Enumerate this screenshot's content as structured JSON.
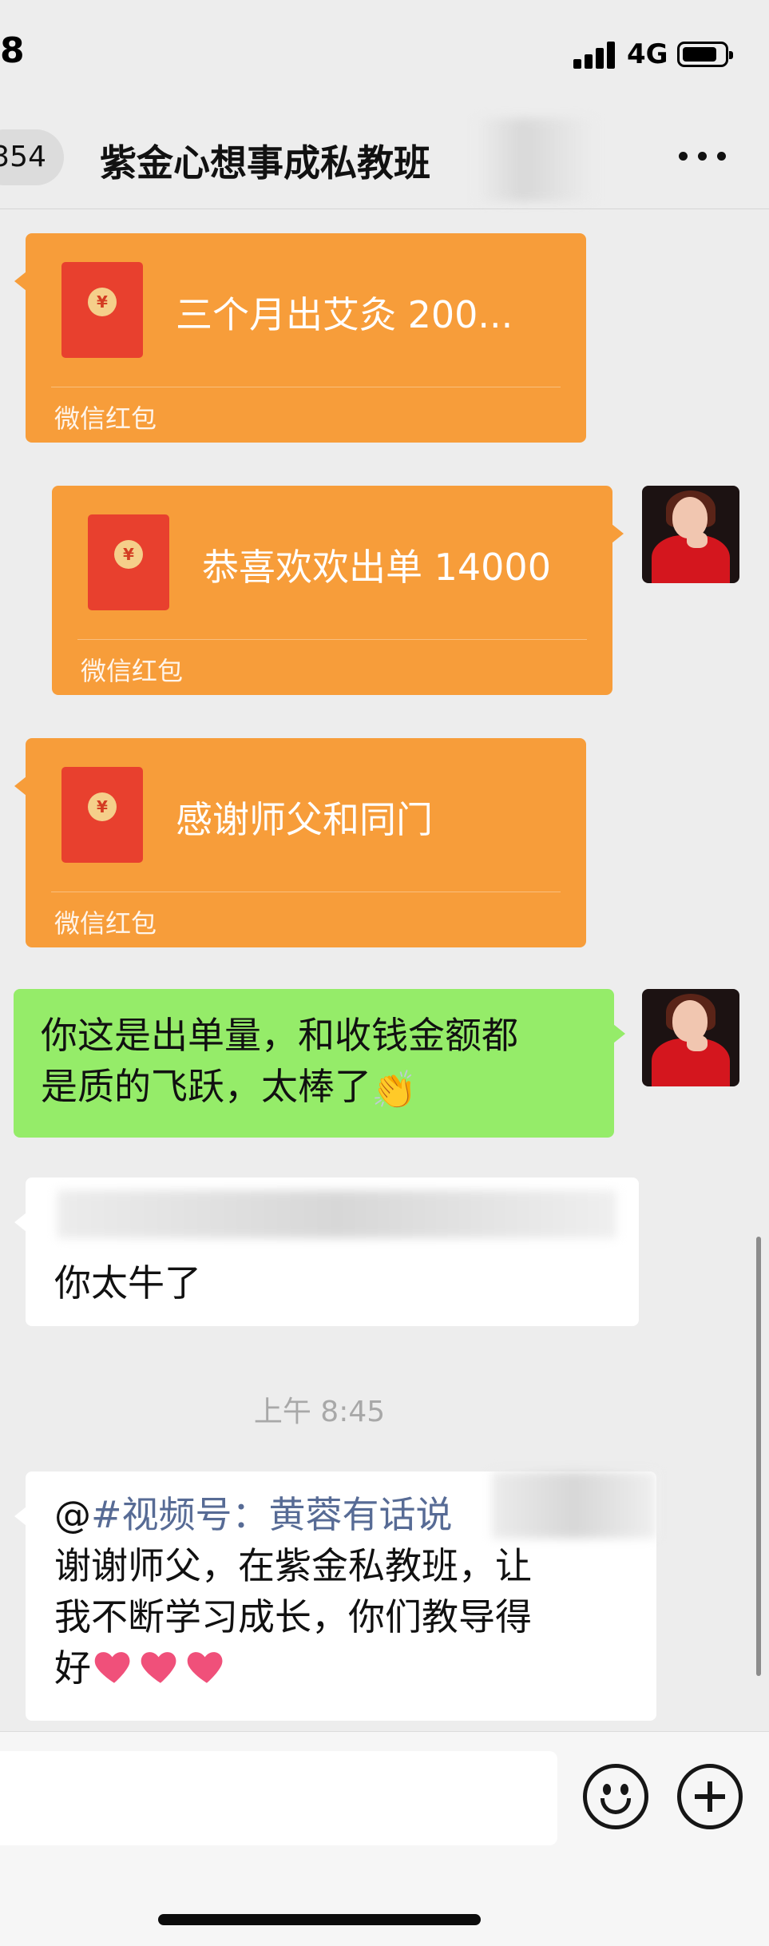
{
  "status_bar": {
    "time": "8",
    "network": "4G",
    "icons": [
      "signal-icon",
      "battery-icon"
    ]
  },
  "nav": {
    "back_count": "354",
    "title": "紫金心想事成私教班",
    "more_icon": "more-icon"
  },
  "messages": {
    "packet_1": {
      "title": "三个月出艾灸 200...",
      "footer": "微信红包"
    },
    "packet_2": {
      "title": "恭喜欢欢出单 14000",
      "footer": "微信红包"
    },
    "packet_3": {
      "title": "感谢师父和同门",
      "footer": "微信红包"
    },
    "green_msg": {
      "line1": "你这是出单量，和收钱金额都",
      "line2": "是质的飞跃，太棒了",
      "emoji": "👏"
    },
    "white_msg_1": {
      "text": "你太牛了"
    },
    "time_divider": "上午 8:45",
    "white_msg_2": {
      "at": "@",
      "mention": "#视频号：黄蓉有话说",
      "line1": " 谢谢师父，在紫金私教班，让",
      "line2": "我不断学习成长，你们教导得",
      "line3": "好"
    }
  },
  "colors": {
    "packet_orange": "#f79d3a",
    "packet_red": "#e8402e",
    "bubble_green": "#95ec69",
    "mention_blue": "#576b95",
    "background": "#ededed"
  },
  "input_bar": {
    "icons": [
      "emoji-icon",
      "plus-icon"
    ]
  }
}
